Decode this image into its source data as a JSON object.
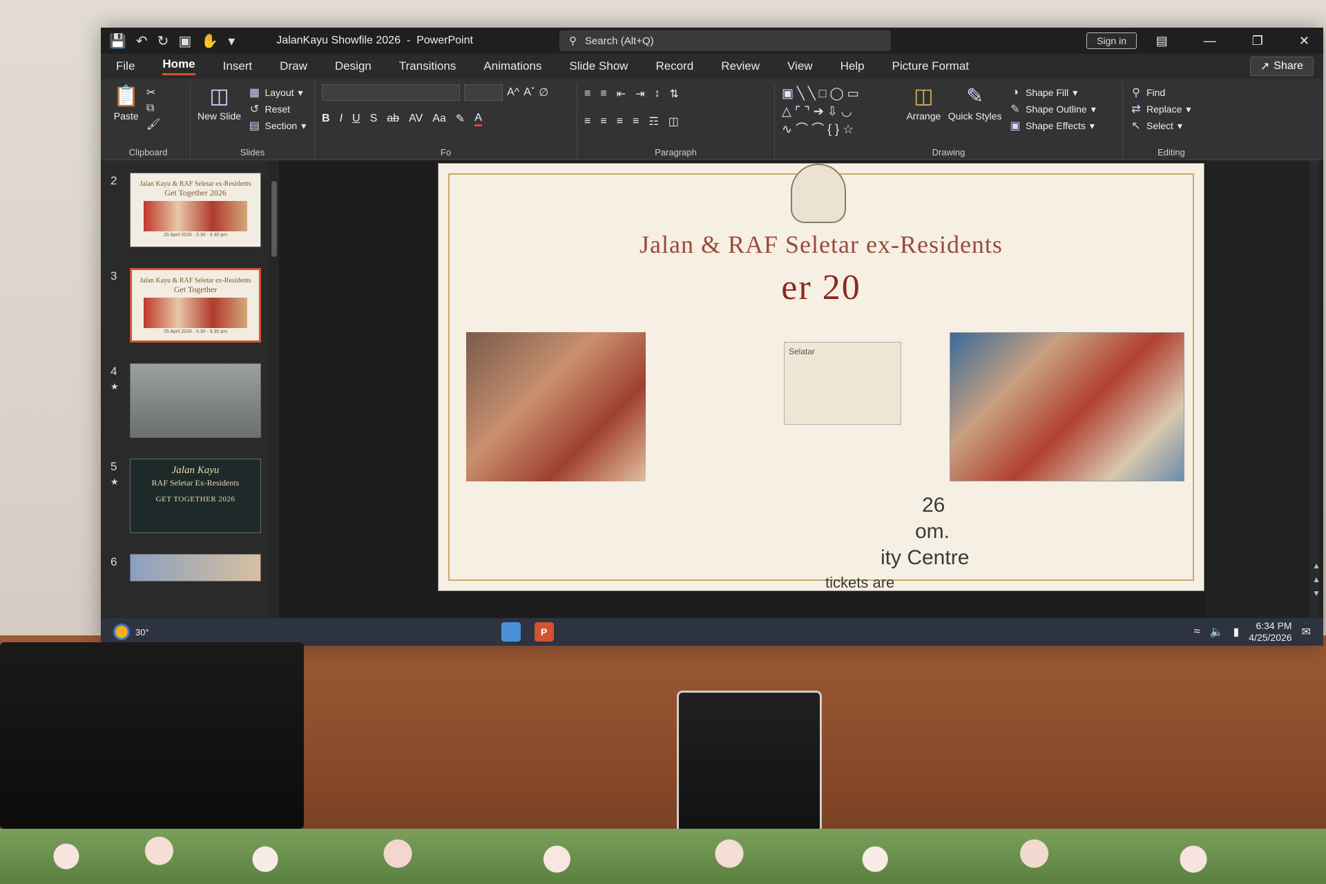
{
  "app": {
    "title": "JalanKayu Showfile 2026",
    "app_name": "PowerPoint",
    "separator": "-",
    "search_placeholder": "Search (Alt+Q)",
    "signin_label": "Sign in",
    "share_label": "Share"
  },
  "menu_tabs": [
    "File",
    "Home",
    "Insert",
    "Draw",
    "Design",
    "Transitions",
    "Animations",
    "Slide Show",
    "Record",
    "Review",
    "View",
    "Help",
    "Picture Format"
  ],
  "active_tab": "Home",
  "ribbon": {
    "clipboard": {
      "label": "Clipboard",
      "paste": "Paste"
    },
    "slides": {
      "label": "Slides",
      "new_slide": "New Slide",
      "layout": "Layout",
      "reset": "Reset",
      "section": "Section"
    },
    "font": {
      "label": "Fo",
      "bold": "B",
      "italic": "I",
      "underline": "U",
      "strike": "S",
      "strike2": "ab",
      "spacing": "AV",
      "case": "Aa",
      "grow": "A^",
      "shrink": "Aˇ"
    },
    "paragraph": {
      "label": "Paragraph"
    },
    "drawing": {
      "label": "Drawing",
      "arrange": "Arrange",
      "quick_styles": "Quick Styles",
      "shape_fill": "Shape Fill",
      "shape_outline": "Shape Outline",
      "shape_effects": "Shape Effects"
    },
    "editing": {
      "label": "Editing",
      "find": "Find",
      "replace": "Replace",
      "select": "Select"
    }
  },
  "thumbnails": [
    {
      "num": "2",
      "title_small": "Jalan Kayu & RAF Seletar ex-Residents",
      "title_big": "Get Together 2026",
      "caption": "25 April 2026 · 5.30 - 9.30 pm",
      "kind": "photo"
    },
    {
      "num": "3",
      "title_small": "Jalan Kayu & RAF Seletar ex-Residents",
      "title_big": "Get Together",
      "caption": "25 April 2026 · 5.30 - 9.30 pm",
      "kind": "photo",
      "selected": true
    },
    {
      "num": "4",
      "kind": "bw",
      "star": "★"
    },
    {
      "num": "5",
      "kind": "dark",
      "star": "★",
      "line_a": "Jalan Kayu",
      "line_b": "RAF Seletar Ex-Residents",
      "line_c": "GET TOGETHER 2026"
    },
    {
      "num": "6",
      "kind": "photo2"
    }
  ],
  "slide": {
    "title_partial": "Jalan      & RAF Seletar ex-Residents",
    "subtitle_partial": "er 20",
    "notice_text": "Selatar",
    "line1": "26",
    "line2": "om.",
    "line3": "ity Centre",
    "line4": "tickets are"
  },
  "taskbar": {
    "temperature": "30°",
    "time": "6:34 PM",
    "date": "4/25/2026"
  },
  "colors": {
    "accent": "#d35230",
    "window_bg": "#2b2b2b",
    "slide_bg": "#f6efe3",
    "slide_title": "#9a4a3a"
  }
}
